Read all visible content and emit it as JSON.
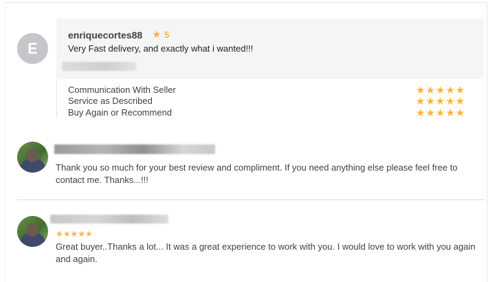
{
  "review": {
    "avatar_initial": "E",
    "username": "enriquecortes88",
    "rating_icon": "star-icon",
    "rating": "5",
    "text": "Very Fast delivery, and exactly what i wanted!!!",
    "criteria": [
      {
        "label": "Communication With Seller",
        "stars": "★★★★★",
        "rating": 5
      },
      {
        "label": "Service as Described",
        "stars": "★★★★★",
        "rating": 5
      },
      {
        "label": "Buy Again or Recommend",
        "stars": "★★★★★",
        "rating": 5
      }
    ]
  },
  "seller_response": {
    "text": "Thank you so much for your best review and compliment. If you need anything else please feel free to contact me. Thanks...!!!"
  },
  "seller_review": {
    "stars": "★★★★★",
    "rating": 5,
    "text": "Great buyer..Thanks a lot... It was a great experience to work with you. I would love to work with you again and again."
  },
  "colors": {
    "star": "#ffb33e",
    "text": "#404145",
    "box_bg": "#f5f5f5",
    "avatar_bg": "#c5c6c9"
  }
}
